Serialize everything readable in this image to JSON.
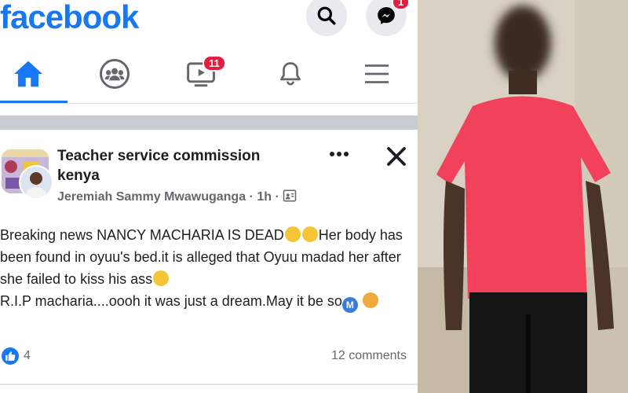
{
  "app": {
    "logo_text": "facebook"
  },
  "header": {
    "messenger_badge": "1"
  },
  "nav": {
    "items": [
      {
        "name": "home",
        "active": true
      },
      {
        "name": "groups"
      },
      {
        "name": "watch",
        "badge": "11"
      },
      {
        "name": "notifications"
      },
      {
        "name": "menu"
      }
    ]
  },
  "post": {
    "title": "Teacher service commission kenya",
    "author": "Jeremiah Sammy Mwawuganga",
    "time": "1h",
    "body_part1": "Breaking news NANCY MACHARIA IS DEAD",
    "body_part2": "Her body has been found in oyuu's bed.it is alleged that Oyuu madad her after she failed to kiss his ass",
    "body_part3": "R.I.P macharia....oooh it was just a dream.May it be so",
    "m_icon_letter": "M",
    "like_count": "4",
    "comments": "12 comments"
  },
  "colors": {
    "brand": "#1877f2",
    "badge": "#e41e3f",
    "shirt": "#f2415b"
  }
}
